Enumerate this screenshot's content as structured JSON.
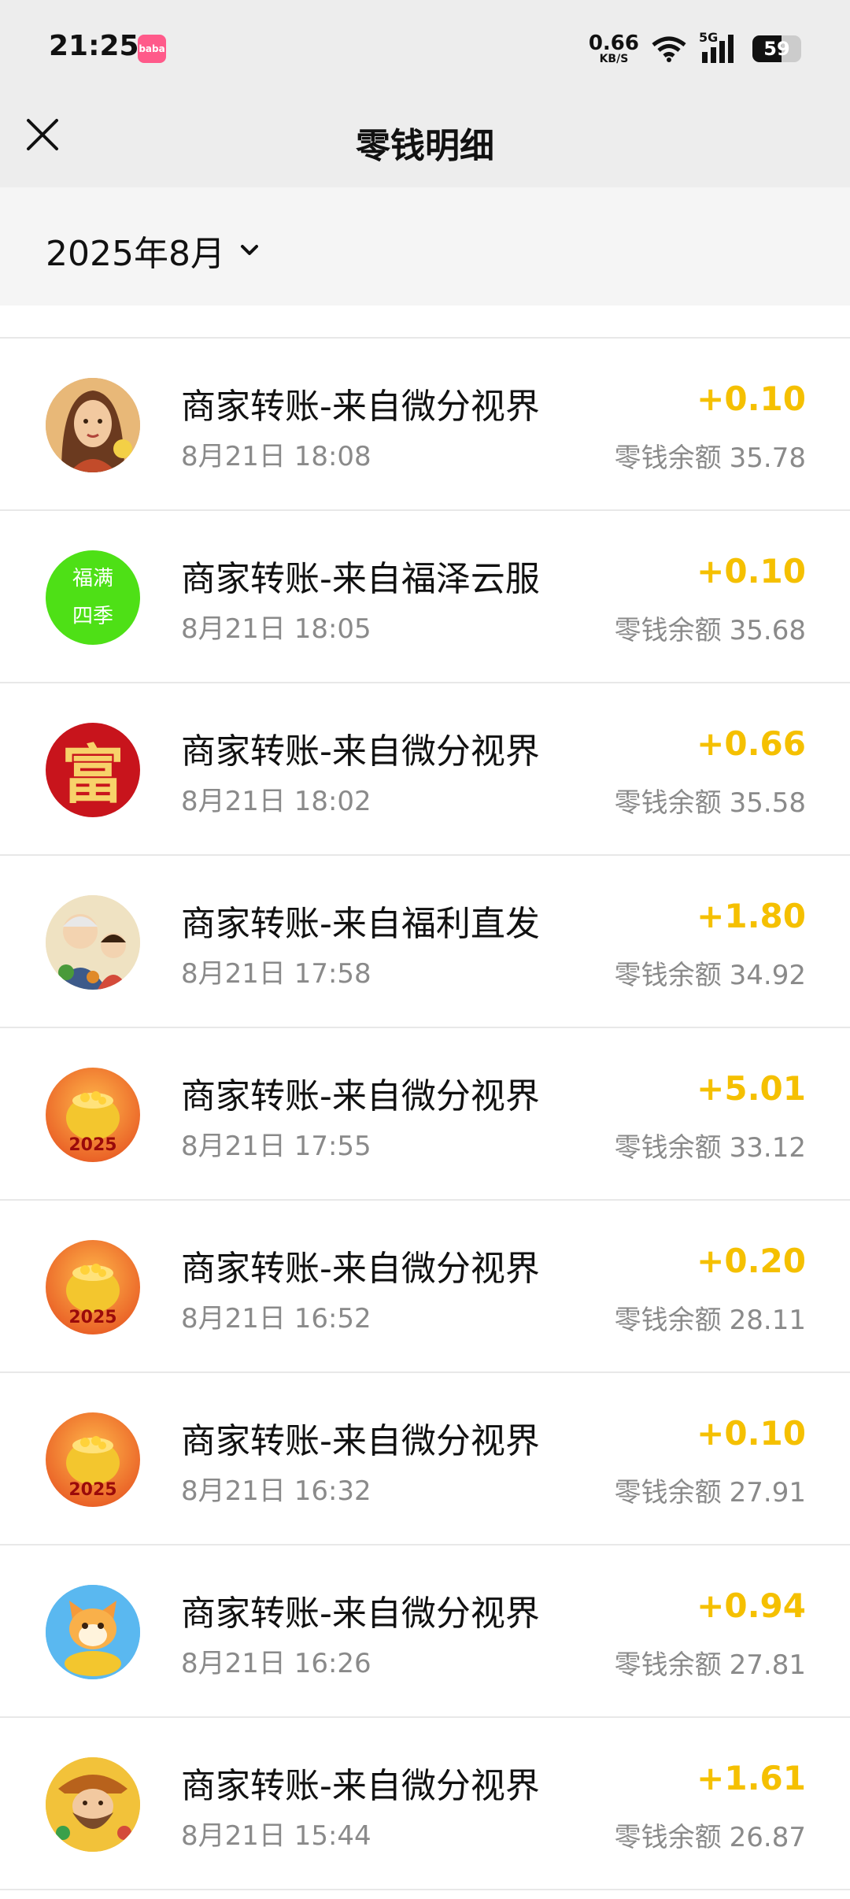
{
  "status_bar": {
    "time": "21:25",
    "app_badge": "baba",
    "net_speed_value": "0.66",
    "net_speed_unit": "KB/S",
    "network_type": "5G",
    "battery_level": "59"
  },
  "nav": {
    "title": "零钱明细"
  },
  "filter": {
    "month": "2025年8月"
  },
  "transactions": [
    {
      "title": "商家转账-来自微分视界",
      "time": "8月21日 18:08",
      "amount": "+0.10",
      "balance_label": "零钱余额",
      "balance": "35.78",
      "avatar": "woman-portrait"
    },
    {
      "title": "商家转账-来自福泽云服",
      "time": "8月21日 18:05",
      "amount": "+0.10",
      "balance_label": "零钱余额",
      "balance": "35.68",
      "avatar": "green-text",
      "avatar_text": "福满四季"
    },
    {
      "title": "商家转账-来自微分视界",
      "time": "8月21日 18:02",
      "amount": "+0.66",
      "balance_label": "零钱余额",
      "balance": "35.58",
      "avatar": "fu-character",
      "avatar_text": "富"
    },
    {
      "title": "商家转账-来自福利直发",
      "time": "8月21日 17:58",
      "amount": "+1.80",
      "balance_label": "零钱余额",
      "balance": "34.92",
      "avatar": "grandparent-child"
    },
    {
      "title": "商家转账-来自微分视界",
      "time": "8月21日 17:55",
      "amount": "+5.01",
      "balance_label": "零钱余额",
      "balance": "33.12",
      "avatar": "gold-pot-2025",
      "avatar_text": "2025"
    },
    {
      "title": "商家转账-来自微分视界",
      "time": "8月21日 16:52",
      "amount": "+0.20",
      "balance_label": "零钱余额",
      "balance": "28.11",
      "avatar": "gold-pot-2025",
      "avatar_text": "2025"
    },
    {
      "title": "商家转账-来自微分视界",
      "time": "8月21日 16:32",
      "amount": "+0.10",
      "balance_label": "零钱余额",
      "balance": "27.91",
      "avatar": "gold-pot-2025",
      "avatar_text": "2025"
    },
    {
      "title": "商家转账-来自微分视界",
      "time": "8月21日 16:26",
      "amount": "+0.94",
      "balance_label": "零钱余额",
      "balance": "27.81",
      "avatar": "lucky-cat"
    },
    {
      "title": "商家转账-来自微分视界",
      "time": "8月21日 15:44",
      "amount": "+1.61",
      "balance_label": "零钱余额",
      "balance": "26.87",
      "avatar": "bearded-man"
    }
  ],
  "colors": {
    "amount": "#f5c000",
    "header_bg": "#ededed",
    "filter_bg": "#f5f5f5",
    "secondary_text": "#8a8a8a"
  }
}
